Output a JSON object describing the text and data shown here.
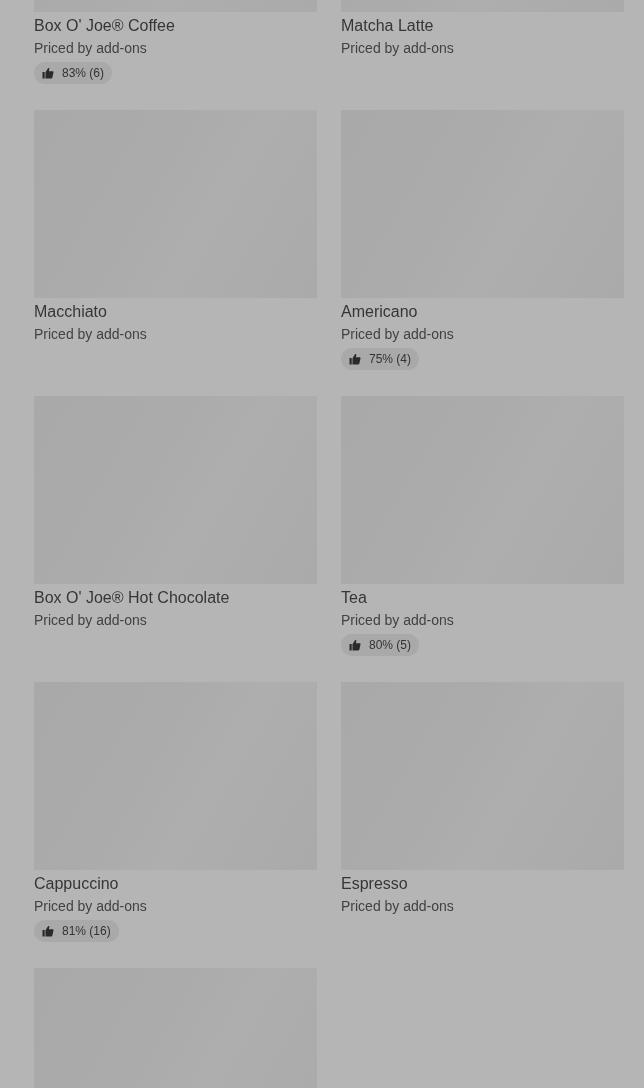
{
  "items": [
    {
      "kind": "product",
      "title": "Box O' Joe® Coffee",
      "subtitle": "Priced by add-ons",
      "rating": "83% (6)"
    },
    {
      "kind": "product",
      "title": "Matcha Latte",
      "subtitle": "Priced by add-ons"
    },
    {
      "kind": "product",
      "title": "Macchiato",
      "subtitle": "Priced by add-ons"
    },
    {
      "kind": "product",
      "title": "Americano",
      "subtitle": "Priced by add-ons",
      "rating": "75% (4)"
    },
    {
      "kind": "product",
      "title": "Box O' Joe® Hot Chocolate",
      "subtitle": "Priced by add-ons"
    },
    {
      "kind": "product",
      "title": "Tea",
      "subtitle": "Priced by add-ons",
      "rating": "80% (5)"
    },
    {
      "kind": "product",
      "title": "Cappuccino",
      "subtitle": "Priced by add-ons",
      "rating": "81% (16)"
    },
    {
      "kind": "product",
      "title": "Espresso",
      "subtitle": "Priced by add-ons"
    },
    {
      "kind": "image_only"
    }
  ]
}
